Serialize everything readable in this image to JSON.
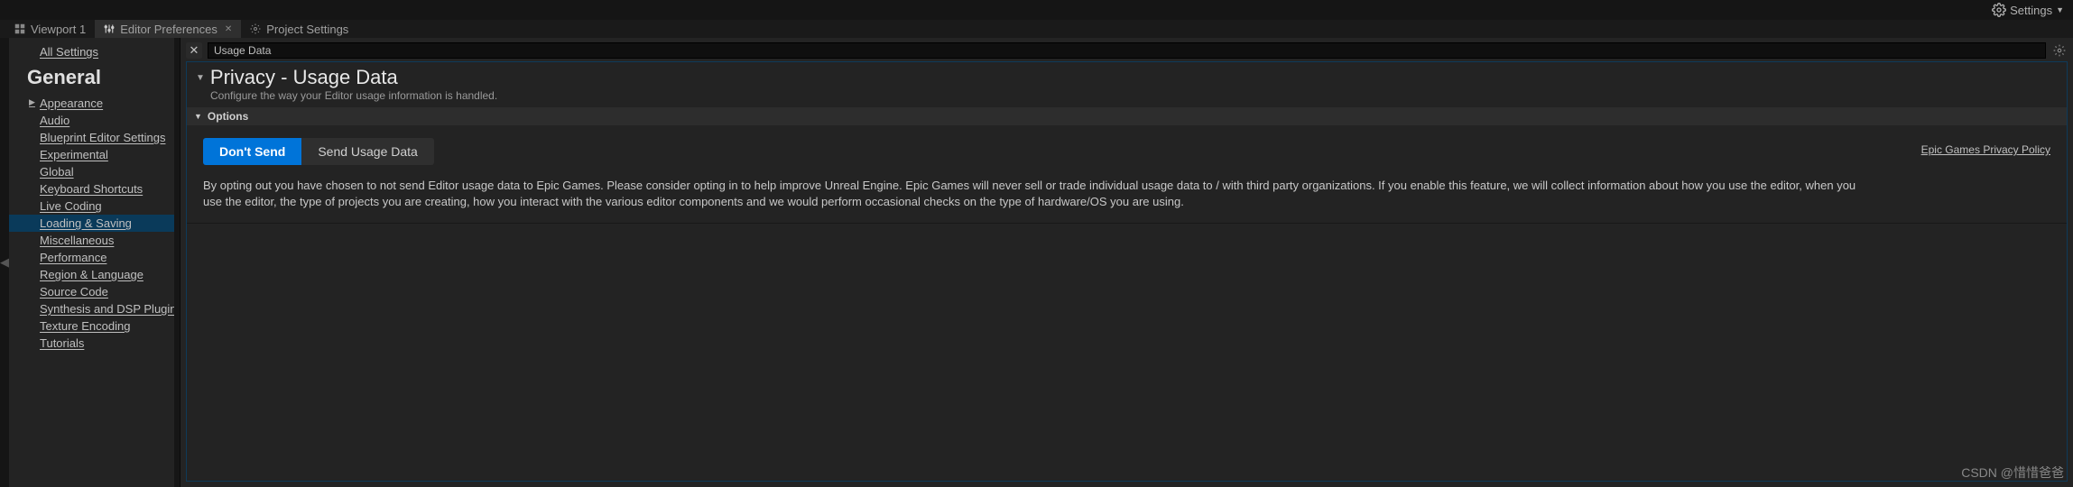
{
  "topbar": {
    "settings_label": "Settings"
  },
  "tabs": [
    {
      "label": "Viewport 1",
      "active": false,
      "icon": "grid-icon",
      "closable": false
    },
    {
      "label": "Editor Preferences",
      "active": true,
      "icon": "sliders-icon",
      "closable": true
    },
    {
      "label": "Project Settings",
      "active": false,
      "icon": "gear-icon",
      "closable": false
    }
  ],
  "sidebar": {
    "all_label": "All Settings",
    "group_heading": "General",
    "items": [
      {
        "label": "Appearance",
        "expandable": true
      },
      {
        "label": "Audio"
      },
      {
        "label": "Blueprint Editor Settings"
      },
      {
        "label": "Experimental"
      },
      {
        "label": "Global"
      },
      {
        "label": "Keyboard Shortcuts"
      },
      {
        "label": "Live Coding"
      },
      {
        "label": "Loading & Saving",
        "selected": true
      },
      {
        "label": "Miscellaneous"
      },
      {
        "label": "Performance"
      },
      {
        "label": "Region & Language"
      },
      {
        "label": "Source Code"
      },
      {
        "label": "Synthesis and DSP Plugin"
      },
      {
        "label": "Texture Encoding"
      },
      {
        "label": "Tutorials"
      }
    ]
  },
  "search": {
    "value": "Usage Data"
  },
  "page": {
    "title": "Privacy - Usage Data",
    "subtitle": "Configure the way your Editor usage information is handled.",
    "section_label": "Options",
    "btn_dont_send": "Don't Send",
    "btn_send": "Send Usage Data",
    "policy_link": "Epic Games Privacy Policy",
    "description": "By opting out you have chosen to not send Editor usage data to Epic Games. Please consider opting in to help improve Unreal Engine. Epic Games will never sell or trade individual usage data to / with third party organizations. If you enable this feature, we will collect information about how you use the editor, when you use the editor, the type of projects you are creating, how you interact with the various editor components and we would perform occasional checks on the type of hardware/OS you are using."
  },
  "watermark": "CSDN @惜惜爸爸"
}
